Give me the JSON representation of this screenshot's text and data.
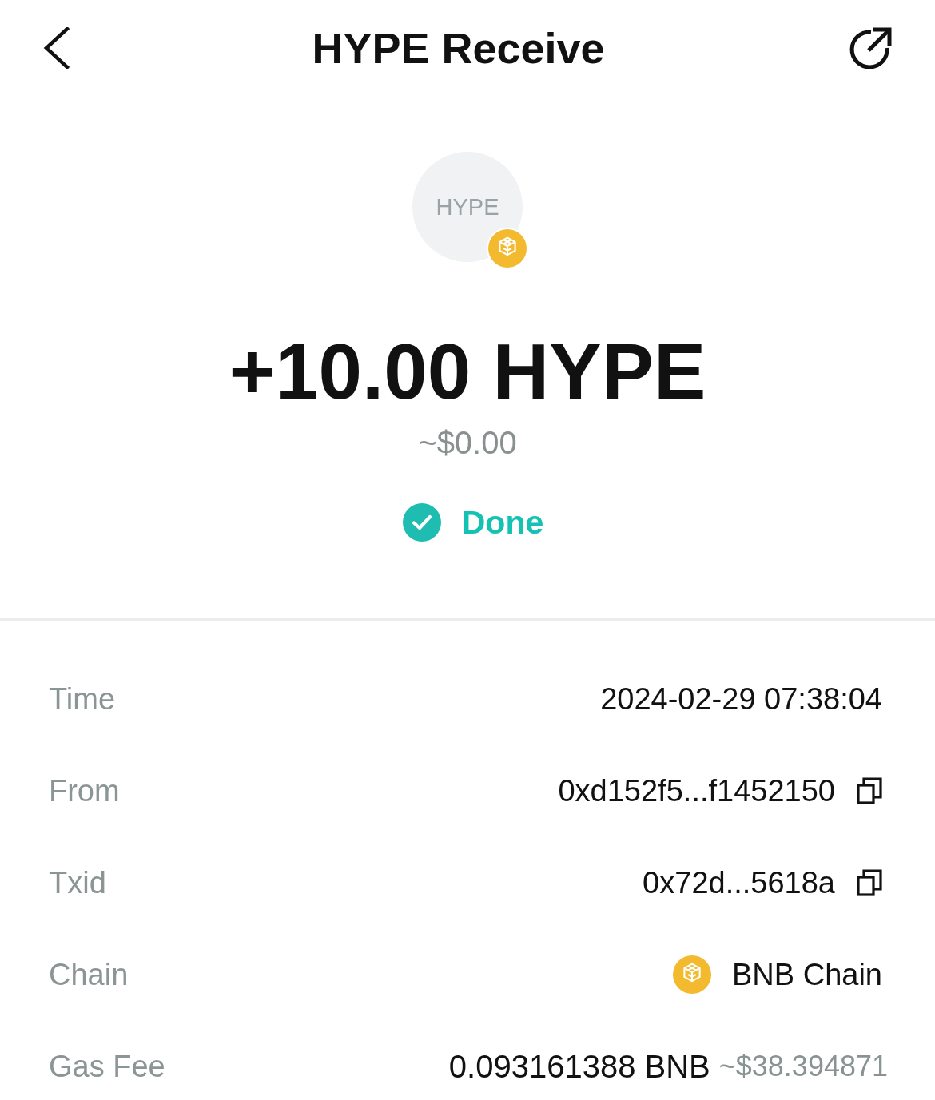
{
  "header": {
    "title": "HYPE Receive"
  },
  "token": {
    "symbol": "HYPE",
    "amount": "+10.00 HYPE",
    "fiat": "~$0.00",
    "status": {
      "kind": "done",
      "label": "Done"
    }
  },
  "details": [
    {
      "kind": "text",
      "label": "Time",
      "value": "2024-02-29 07:38:04"
    },
    {
      "kind": "copy",
      "label": "From",
      "value": "0xd152f5...f1452150"
    },
    {
      "kind": "copy",
      "label": "Txid",
      "value": "0x72d...5618a"
    },
    {
      "kind": "chain",
      "label": "Chain",
      "value": "BNB Chain"
    },
    {
      "kind": "fee",
      "label": "Gas Fee",
      "value": "0.093161388 BNB",
      "fiat": "~$38.394871"
    }
  ]
}
